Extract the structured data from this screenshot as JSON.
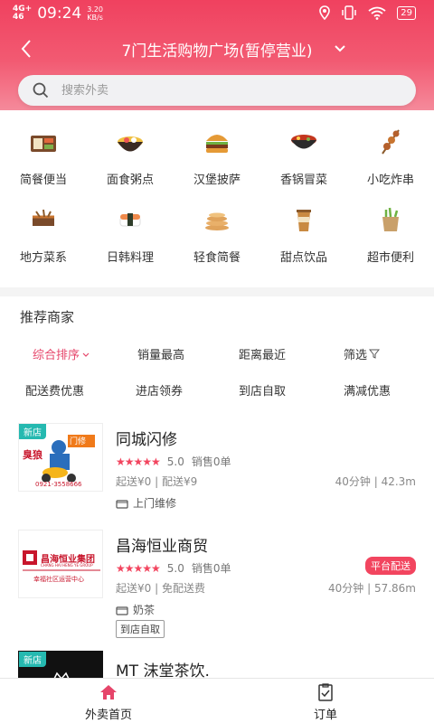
{
  "status_bar": {
    "network": "4G+",
    "network_sub": "46",
    "time": "09:24",
    "speed_value": "3.20",
    "speed_unit": "KB/s",
    "battery": "29",
    "icons": [
      "location-icon",
      "vibrate-icon",
      "wifi-icon",
      "battery-icon"
    ]
  },
  "nav": {
    "title": "7门生活购物广场(暂停营业)",
    "back_icon": "chevron-left-icon",
    "dropdown_icon": "chevron-down-icon"
  },
  "search": {
    "placeholder": "搜索外卖",
    "value": ""
  },
  "categories": [
    {
      "label": "简餐便当",
      "icon": "bento-box-icon"
    },
    {
      "label": "面食粥点",
      "icon": "noodle-bowl-icon"
    },
    {
      "label": "汉堡披萨",
      "icon": "burger-icon"
    },
    {
      "label": "香锅冒菜",
      "icon": "hot-pot-icon"
    },
    {
      "label": "小吃炸串",
      "icon": "skewer-icon"
    },
    {
      "label": "地方菜系",
      "icon": "regional-dish-icon"
    },
    {
      "label": "日韩料理",
      "icon": "sushi-icon"
    },
    {
      "label": "轻食简餐",
      "icon": "pancake-icon"
    },
    {
      "label": "甜点饮品",
      "icon": "drink-cup-icon"
    },
    {
      "label": "超市便利",
      "icon": "grocery-bag-icon"
    }
  ],
  "section": {
    "title": "推荐商家"
  },
  "sort_options": [
    {
      "label": "综合排序",
      "active": true
    },
    {
      "label": "销量最高",
      "active": false
    },
    {
      "label": "距离最近",
      "active": false
    },
    {
      "label": "筛选",
      "active": false
    }
  ],
  "filter_options": [
    "配送费优惠",
    "进店领券",
    "到店自取",
    "满减优惠"
  ],
  "shops": [
    {
      "name": "同城闪修",
      "tag_new": "新店",
      "rating": "5.0",
      "sales": "销售0单",
      "min_order": "起送¥0",
      "delivery_fee": "配送¥9",
      "time": "40分钟",
      "distance": "42.3m",
      "category": "上门维修",
      "logo": {
        "sign": "门修",
        "brand": "臭狼",
        "phone": "0921-3558666"
      }
    },
    {
      "name": "昌海恒业商贸",
      "rating": "5.0",
      "sales": "销售0单",
      "min_order": "起送¥0",
      "delivery_fee": "免配送费",
      "time": "40分钟",
      "distance": "57.86m",
      "category": "奶茶",
      "badge": "平台配送",
      "pickup_tag": "到店自取",
      "logo": {
        "cn": "昌海恒业集团",
        "en": "CHANG HAI HENG YE GROUP",
        "sub": "幸福社区运营中心"
      }
    },
    {
      "name": "MT 沫堂茶饮.",
      "tag_new": "新店"
    }
  ],
  "tabs": [
    {
      "label": "外卖首页",
      "icon": "home-icon",
      "active": true
    },
    {
      "label": "订单",
      "icon": "order-icon",
      "active": false
    }
  ],
  "colors": {
    "header": "#f0415f",
    "accent": "#f2455f",
    "new_tag": "#25b9b0",
    "logo_red": "#c8162c"
  }
}
